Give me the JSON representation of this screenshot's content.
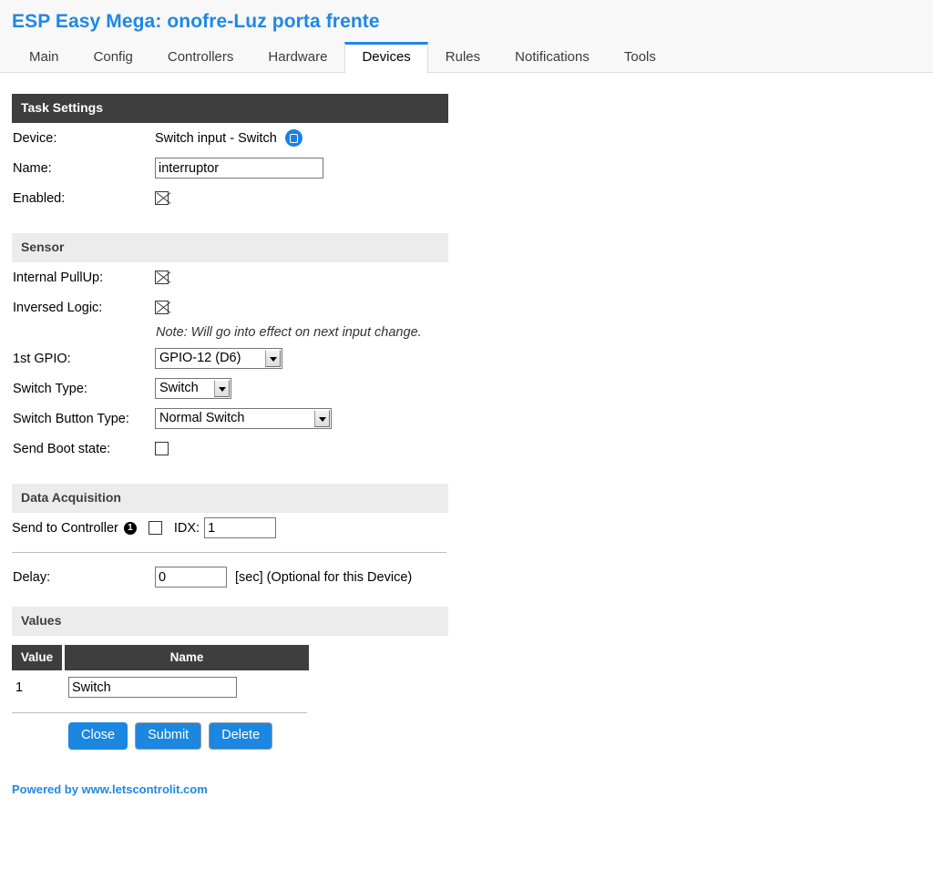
{
  "header": {
    "title": "ESP Easy Mega: onofre-Luz porta frente",
    "title_color": "#1e88e5",
    "tabs": [
      {
        "label": "Main",
        "active": false
      },
      {
        "label": "Config",
        "active": false
      },
      {
        "label": "Controllers",
        "active": false
      },
      {
        "label": "Hardware",
        "active": false
      },
      {
        "label": "Devices",
        "active": true
      },
      {
        "label": "Rules",
        "active": false
      },
      {
        "label": "Notifications",
        "active": false
      },
      {
        "label": "Tools",
        "active": false
      }
    ]
  },
  "task_settings": {
    "section_title": "Task Settings",
    "device_label": "Device:",
    "device_value": "Switch input - Switch",
    "device_icon": "device-info-icon",
    "name_label": "Name:",
    "name_value": "interruptor",
    "name_placeholder": "",
    "enabled_label": "Enabled:",
    "enabled_checked": true
  },
  "sensor": {
    "section_title": "Sensor",
    "internal_pullup_label": "Internal PullUp:",
    "internal_pullup_checked": true,
    "inversed_logic_label": "Inversed Logic:",
    "inversed_logic_checked": true,
    "note": "Note: Will go into effect on next input change.",
    "gpio_label": "1st GPIO:",
    "gpio_value": "GPIO-12 (D6)",
    "switch_type_label": "Switch Type:",
    "switch_type_value": "Switch",
    "switch_button_type_label": "Switch Button Type:",
    "switch_button_type_value": "Normal Switch",
    "send_boot_state_label": "Send Boot state:",
    "send_boot_state_checked": false
  },
  "data_acquisition": {
    "section_title": "Data Acquisition",
    "send_to_controller_label": "Send to Controller",
    "controller_number": "1",
    "send_to_controller_checked": false,
    "idx_label": "IDX:",
    "idx_value": "1",
    "delay_label": "Delay:",
    "delay_value": "0",
    "delay_suffix": "[sec] (Optional for this Device)"
  },
  "values": {
    "section_title": "Values",
    "columns": [
      "Value",
      "Name"
    ],
    "rows": [
      {
        "index": "1",
        "name": "Switch"
      }
    ]
  },
  "actions": {
    "close_label": "Close",
    "submit_label": "Submit",
    "delete_label": "Delete",
    "button_color": "#1b87e0"
  },
  "footer": {
    "text": "Powered by www.letscontrolit.com"
  }
}
